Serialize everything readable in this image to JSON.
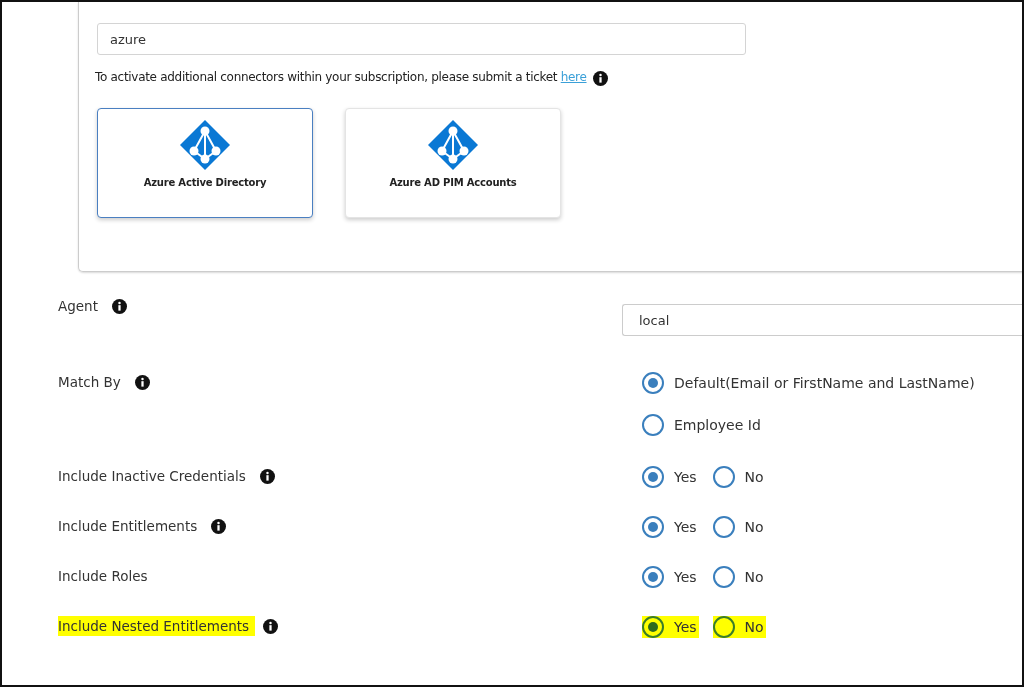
{
  "search": {
    "value": "azure"
  },
  "hint": {
    "text": "To activate additional connectors within your subscription, please submit a ticket",
    "link": "here"
  },
  "connectors": [
    {
      "name": "Azure Active Directory",
      "selected": true
    },
    {
      "name": "Azure AD PIM Accounts",
      "selected": false
    }
  ],
  "fields": [
    {
      "kind": "select",
      "label": "Agent",
      "info": true,
      "highlighted": false,
      "value": "local"
    },
    {
      "kind": "radio",
      "label": "Match By",
      "info": true,
      "highlighted": false,
      "stacked": true,
      "options": [
        {
          "label": "Default(Email or FirstName and LastName)",
          "selected": true
        },
        {
          "label": "Employee Id",
          "selected": false
        }
      ]
    },
    {
      "kind": "radio",
      "label": "Include Inactive Credentials",
      "info": true,
      "highlighted": false,
      "stacked": false,
      "options": [
        {
          "label": "Yes",
          "selected": true
        },
        {
          "label": "No",
          "selected": false
        }
      ]
    },
    {
      "kind": "radio",
      "label": "Include Entitlements",
      "info": true,
      "highlighted": false,
      "stacked": false,
      "options": [
        {
          "label": "Yes",
          "selected": true
        },
        {
          "label": "No",
          "selected": false
        }
      ]
    },
    {
      "kind": "radio",
      "label": "Include Roles",
      "info": false,
      "highlighted": false,
      "stacked": false,
      "options": [
        {
          "label": "Yes",
          "selected": true
        },
        {
          "label": "No",
          "selected": false
        }
      ]
    },
    {
      "kind": "radio",
      "label": "Include Nested Entitlements",
      "info": true,
      "highlighted": true,
      "stacked": false,
      "options": [
        {
          "label": "Yes",
          "selected": true
        },
        {
          "label": "No",
          "selected": false
        }
      ]
    }
  ]
}
